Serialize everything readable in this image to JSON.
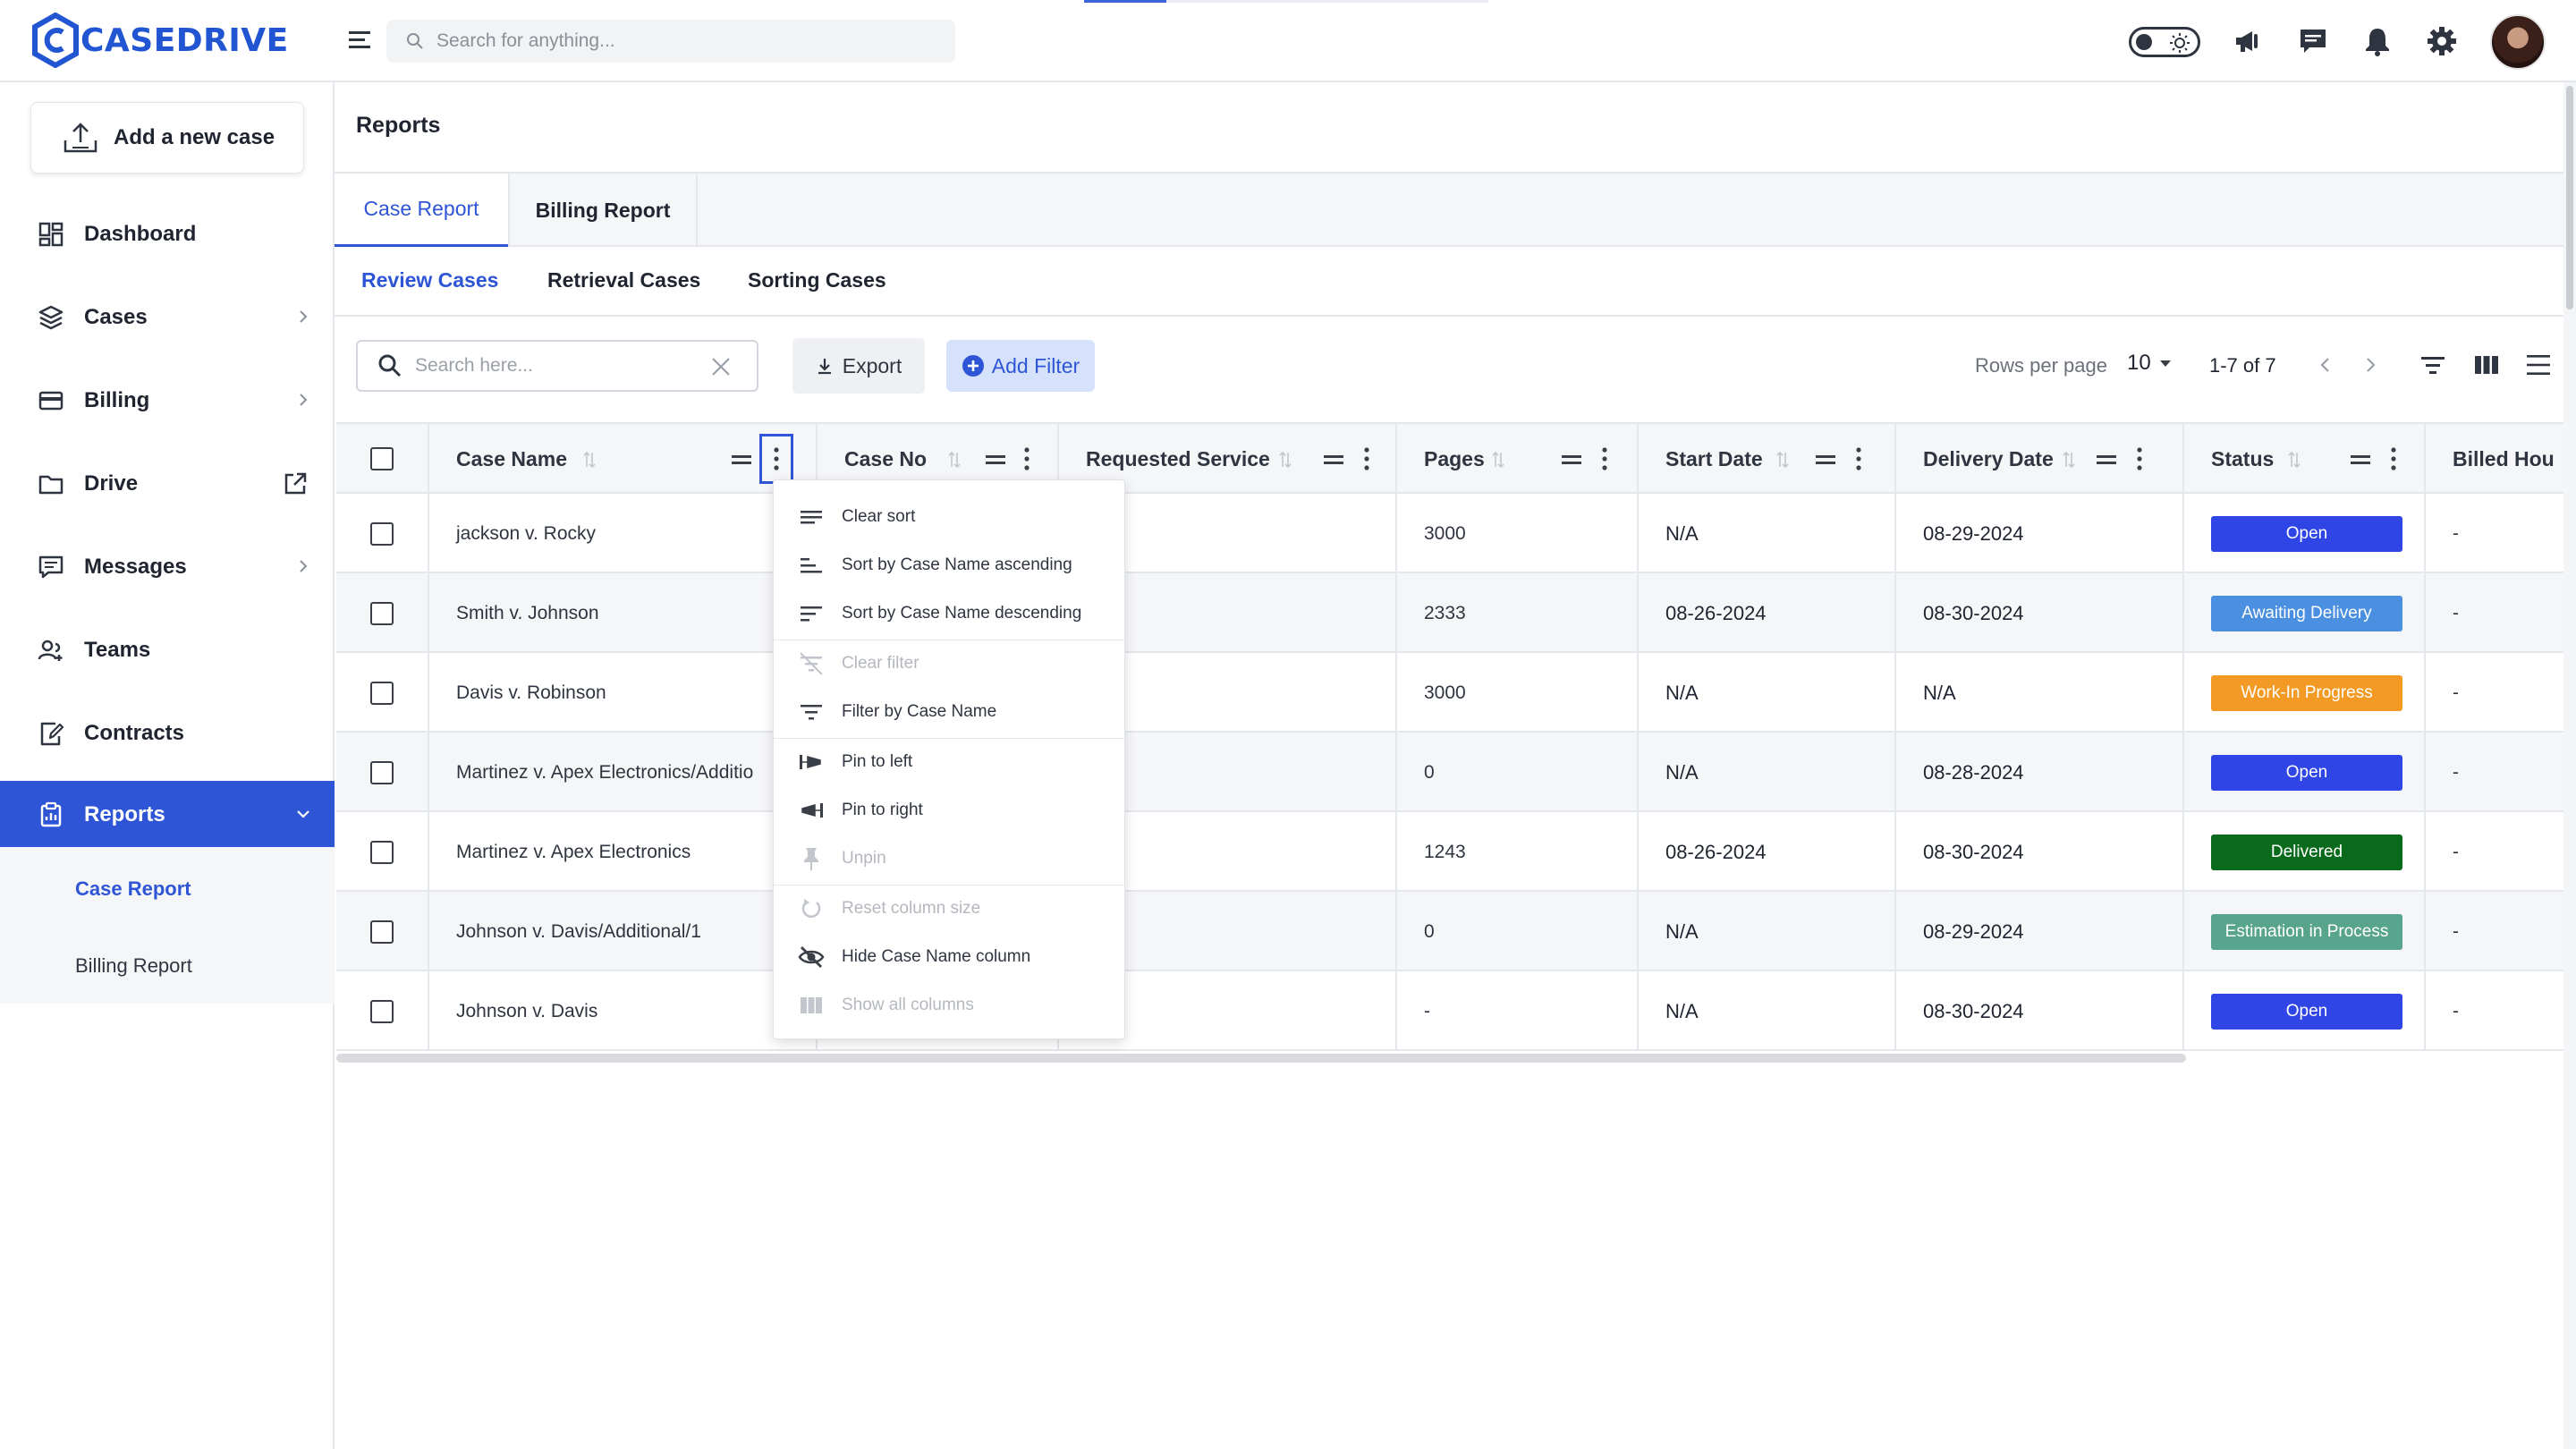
{
  "app": {
    "brand": "CASEDRIVE",
    "colors": {
      "accent": "#2e55d6",
      "text": "#1f2430",
      "muted": "#6b717b"
    }
  },
  "header": {
    "search_placeholder": "Search for anything...",
    "icons": [
      "menu-icon",
      "theme-toggle",
      "megaphone-icon",
      "chat-icon",
      "bell-icon",
      "gear-icon",
      "avatar"
    ]
  },
  "sidebar": {
    "add_case_label": "Add a new case",
    "items": [
      {
        "label": "Dashboard",
        "icon": "dashboard-icon"
      },
      {
        "label": "Cases",
        "icon": "layers-icon"
      },
      {
        "label": "Billing",
        "icon": "card-icon"
      },
      {
        "label": "Drive",
        "icon": "folder-icon"
      },
      {
        "label": "Messages",
        "icon": "message-icon"
      },
      {
        "label": "Teams",
        "icon": "team-icon"
      },
      {
        "label": "Contracts",
        "icon": "contract-icon"
      },
      {
        "label": "Reports",
        "icon": "report-icon"
      }
    ],
    "sub_items": [
      "Case Report",
      "Billing Report"
    ]
  },
  "page": {
    "title": "Reports",
    "tabs": [
      "Case Report",
      "Billing Report"
    ],
    "subtabs": [
      "Review Cases",
      "Retrieval Cases",
      "Sorting Cases"
    ]
  },
  "toolbar": {
    "search_placeholder": "Search here...",
    "export_label": "Export",
    "add_filter_label": "Add Filter",
    "rows_per_page_label": "Rows per page",
    "rows_per_page_value": "10",
    "page_range": "1-7 of 7"
  },
  "table": {
    "columns": [
      "Case Name",
      "Case No",
      "Requested Service",
      "Pages",
      "Start Date",
      "Delivery Date",
      "Status",
      "Billed Hou"
    ],
    "rows": [
      {
        "case_name": "jackson v. Rocky",
        "pages": "3000",
        "start": "N/A",
        "delivery": "08-29-2024",
        "status": "Open",
        "billed": "-"
      },
      {
        "case_name": "Smith v. Johnson",
        "pages": "2333",
        "start": "08-26-2024",
        "delivery": "08-30-2024",
        "status": "Awaiting Delivery",
        "billed": "-"
      },
      {
        "case_name": "Davis v. Robinson",
        "pages": "3000",
        "start": "N/A",
        "delivery": "N/A",
        "status": "Work-In Progress",
        "billed": "-"
      },
      {
        "case_name": "Martinez v. Apex Electronics/Additio",
        "pages": "0",
        "start": "N/A",
        "delivery": "08-28-2024",
        "status": "Open",
        "billed": "-"
      },
      {
        "case_name": "Martinez v. Apex Electronics",
        "pages": "1243",
        "start": "08-26-2024",
        "delivery": "08-30-2024",
        "status": "Delivered",
        "billed": "-"
      },
      {
        "case_name": "Johnson v. Davis/Additional/1",
        "pages": "0",
        "start": "N/A",
        "delivery": "08-29-2024",
        "status": "Estimation in Process",
        "billed": "-"
      },
      {
        "case_name": "Johnson v. Davis",
        "pages": "-",
        "start": "N/A",
        "delivery": "08-30-2024",
        "status": "Open",
        "billed": "-"
      }
    ],
    "status_colors": {
      "Open": "#2f45e6",
      "Awaiting Delivery": "#4a8fe0",
      "Work-In Progress": "#f39a24",
      "Delivered": "#0a6a1c",
      "Estimation in Process": "#58a48c"
    }
  },
  "column_menu": {
    "items": [
      {
        "label": "Clear sort",
        "enabled": true
      },
      {
        "label": "Sort by Case Name ascending",
        "enabled": true
      },
      {
        "label": "Sort by Case Name descending",
        "enabled": true
      },
      {
        "label": "Clear filter",
        "enabled": false
      },
      {
        "label": "Filter by Case Name",
        "enabled": true
      },
      {
        "label": "Pin to left",
        "enabled": true
      },
      {
        "label": "Pin to right",
        "enabled": true
      },
      {
        "label": "Unpin",
        "enabled": false
      },
      {
        "label": "Reset column size",
        "enabled": false
      },
      {
        "label": "Hide Case Name column",
        "enabled": true
      },
      {
        "label": "Show all columns",
        "enabled": false
      }
    ]
  }
}
